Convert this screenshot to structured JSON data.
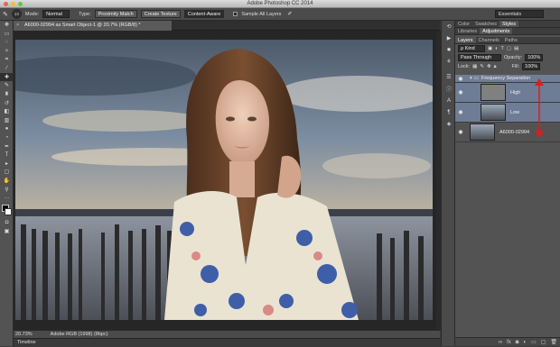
{
  "window": {
    "title": "Adobe Photoshop CC 2014"
  },
  "options_bar": {
    "brush_size": "13",
    "mode_label": "Mode:",
    "mode_value": "Normal",
    "type_label": "Type:",
    "proximity_match": "Proximity Match",
    "create_texture": "Create Texture",
    "content_aware": "Content-Aware",
    "sample_all_layers": "Sample All Layers",
    "workspace": "Essentials"
  },
  "document": {
    "tab_title": "A6000-02994 as Smart Object-1 @ 20.7% (RGB/8) *",
    "zoom": "20.73%",
    "profile": "Adobe RGB (1998) (8bpc)"
  },
  "timeline": {
    "label": "Timeline"
  },
  "panels": {
    "top_tabs": [
      "Color",
      "Swatches",
      "Styles"
    ],
    "top_tabs2": [
      "Libraries",
      "Adjustments"
    ],
    "layer_tabs": [
      "Layers",
      "Channels",
      "Paths"
    ],
    "kind_label": "ρ Kind",
    "blend_mode": "Pass Through",
    "opacity_label": "Opacity:",
    "opacity_value": "100%",
    "lock_label": "Lock:",
    "fill_label": "Fill:",
    "fill_value": "100%"
  },
  "layers": [
    {
      "name": "Frequency Separation",
      "type": "group"
    },
    {
      "name": "High",
      "type": "layer"
    },
    {
      "name": "Low",
      "type": "layer"
    },
    {
      "name": "A6000-02994",
      "type": "layer"
    }
  ],
  "colors": {
    "accent_arrow": "#e11b1b",
    "selection": "#6f7c95"
  }
}
